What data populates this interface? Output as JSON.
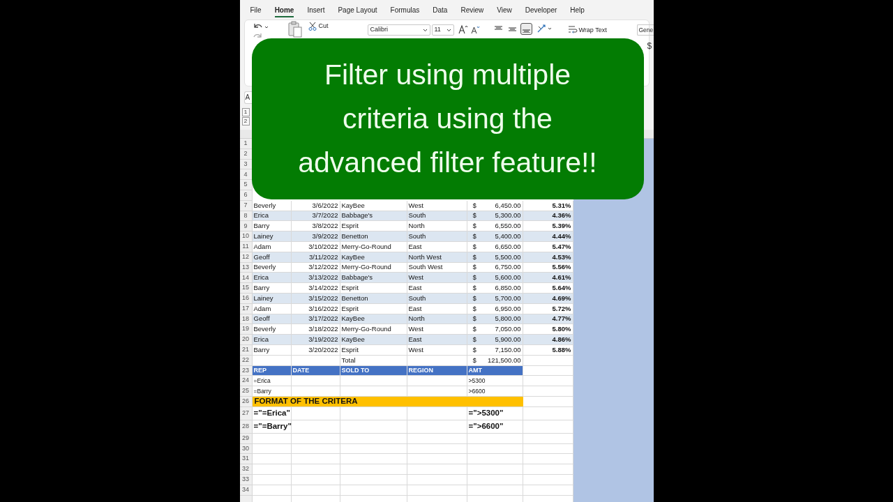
{
  "menu_tabs": [
    {
      "label": "File",
      "selected": false
    },
    {
      "label": "Home",
      "selected": true
    },
    {
      "label": "Insert",
      "selected": false
    },
    {
      "label": "Page Layout",
      "selected": false
    },
    {
      "label": "Formulas",
      "selected": false
    },
    {
      "label": "Data",
      "selected": false
    },
    {
      "label": "Review",
      "selected": false
    },
    {
      "label": "View",
      "selected": false
    },
    {
      "label": "Developer",
      "selected": false
    },
    {
      "label": "Help",
      "selected": false
    }
  ],
  "ribbon": {
    "cut_label": "Cut",
    "font_name": "Calibri",
    "font_size": "11",
    "align_options": [
      {
        "selected": false
      },
      {
        "selected": false
      },
      {
        "selected": true
      }
    ],
    "wrap_text": "Wrap Text",
    "number_format": "Gene",
    "currency_symbol": "$"
  },
  "name_box": "A",
  "outline_levels": [
    "1",
    "2"
  ],
  "overlay": {
    "lines": [
      "Filter using multiple",
      "criteria using the",
      "advanced filter feature!!"
    ]
  },
  "rows": [
    {
      "kind": "covered",
      "number": "1"
    },
    {
      "kind": "covered",
      "number": "2"
    },
    {
      "kind": "covered",
      "number": "3"
    },
    {
      "kind": "covered",
      "number": "4"
    },
    {
      "kind": "covered",
      "number": "5"
    },
    {
      "kind": "covered",
      "number": "6"
    },
    {
      "kind": "data",
      "number": "7",
      "banded": false,
      "rep": "Beverly",
      "date": "3/6/2022",
      "sold_to": "KayBee",
      "region": "West",
      "currency": "$",
      "amount": "6,450.00",
      "share": "5.31%"
    },
    {
      "kind": "data",
      "number": "8",
      "banded": true,
      "rep": "Erica",
      "date": "3/7/2022",
      "sold_to": "Babbage's",
      "region": "South",
      "currency": "$",
      "amount": "5,300.00",
      "share": "4.36%"
    },
    {
      "kind": "data",
      "number": "9",
      "banded": false,
      "rep": "Barry",
      "date": "3/8/2022",
      "sold_to": "Esprit",
      "region": "North",
      "currency": "$",
      "amount": "6,550.00",
      "share": "5.39%"
    },
    {
      "kind": "data",
      "number": "10",
      "banded": true,
      "rep": "Lainey",
      "date": "3/9/2022",
      "sold_to": "Benetton",
      "region": "South",
      "currency": "$",
      "amount": "5,400.00",
      "share": "4.44%"
    },
    {
      "kind": "data",
      "number": "11",
      "banded": false,
      "rep": "Adam",
      "date": "3/10/2022",
      "sold_to": "Merry-Go-Round",
      "region": "East",
      "currency": "$",
      "amount": "6,650.00",
      "share": "5.47%"
    },
    {
      "kind": "data",
      "number": "12",
      "banded": true,
      "rep": "Geoff",
      "date": "3/11/2022",
      "sold_to": "KayBee",
      "region": "North West",
      "currency": "$",
      "amount": "5,500.00",
      "share": "4.53%"
    },
    {
      "kind": "data",
      "number": "13",
      "banded": false,
      "rep": "Beverly",
      "date": "3/12/2022",
      "sold_to": "Merry-Go-Round",
      "region": "South West",
      "currency": "$",
      "amount": "6,750.00",
      "share": "5.56%"
    },
    {
      "kind": "data",
      "number": "14",
      "banded": true,
      "rep": "Erica",
      "date": "3/13/2022",
      "sold_to": "Babbage's",
      "region": "West",
      "currency": "$",
      "amount": "5,600.00",
      "share": "4.61%"
    },
    {
      "kind": "data",
      "number": "15",
      "banded": false,
      "rep": "Barry",
      "date": "3/14/2022",
      "sold_to": "Esprit",
      "region": "East",
      "currency": "$",
      "amount": "6,850.00",
      "share": "5.64%"
    },
    {
      "kind": "data",
      "number": "16",
      "banded": true,
      "rep": "Lainey",
      "date": "3/15/2022",
      "sold_to": "Benetton",
      "region": "South",
      "currency": "$",
      "amount": "5,700.00",
      "share": "4.69%"
    },
    {
      "kind": "data",
      "number": "17",
      "banded": false,
      "rep": "Adam",
      "date": "3/16/2022",
      "sold_to": "Esprit",
      "region": "East",
      "currency": "$",
      "amount": "6,950.00",
      "share": "5.72%"
    },
    {
      "kind": "data",
      "number": "18",
      "banded": true,
      "rep": "Geoff",
      "date": "3/17/2022",
      "sold_to": "KayBee",
      "region": "North",
      "currency": "$",
      "amount": "5,800.00",
      "share": "4.77%"
    },
    {
      "kind": "data",
      "number": "19",
      "banded": false,
      "rep": "Beverly",
      "date": "3/18/2022",
      "sold_to": "Merry-Go-Round",
      "region": "West",
      "currency": "$",
      "amount": "7,050.00",
      "share": "5.80%"
    },
    {
      "kind": "data",
      "number": "20",
      "banded": true,
      "rep": "Erica",
      "date": "3/19/2022",
      "sold_to": "KayBee",
      "region": "East",
      "currency": "$",
      "amount": "5,900.00",
      "share": "4.86%"
    },
    {
      "kind": "data",
      "number": "21",
      "banded": false,
      "rep": "Barry",
      "date": "3/20/2022",
      "sold_to": "Esprit",
      "region": "West",
      "currency": "$",
      "amount": "7,150.00",
      "share": "5.88%"
    },
    {
      "kind": "total",
      "number": "22",
      "label": "Total",
      "currency": "$",
      "amount": "121,500.00"
    },
    {
      "kind": "header",
      "number": "23",
      "columns": [
        "REP",
        "DATE",
        "SOLD TO",
        "REGION",
        "AMT"
      ]
    },
    {
      "kind": "criteria",
      "number": "24",
      "rep": "=Erica",
      "amount": ">5300"
    },
    {
      "kind": "criteria",
      "number": "25",
      "rep": "=Barry",
      "amount": ">6600"
    },
    {
      "kind": "title",
      "number": "26",
      "text": "FORMAT OF THE CRITERA"
    },
    {
      "kind": "formula",
      "number": "27",
      "rep": "=\"=Erica\"",
      "amount": "=\">5300\""
    },
    {
      "kind": "formula",
      "number": "28",
      "rep": "=\"=Barry\"",
      "amount": "=\">6600\""
    },
    {
      "kind": "empty",
      "number": "29"
    },
    {
      "kind": "empty",
      "number": "30"
    },
    {
      "kind": "empty",
      "number": "31"
    },
    {
      "kind": "empty",
      "number": "32"
    },
    {
      "kind": "empty",
      "number": "33"
    },
    {
      "kind": "empty",
      "number": "34"
    }
  ]
}
